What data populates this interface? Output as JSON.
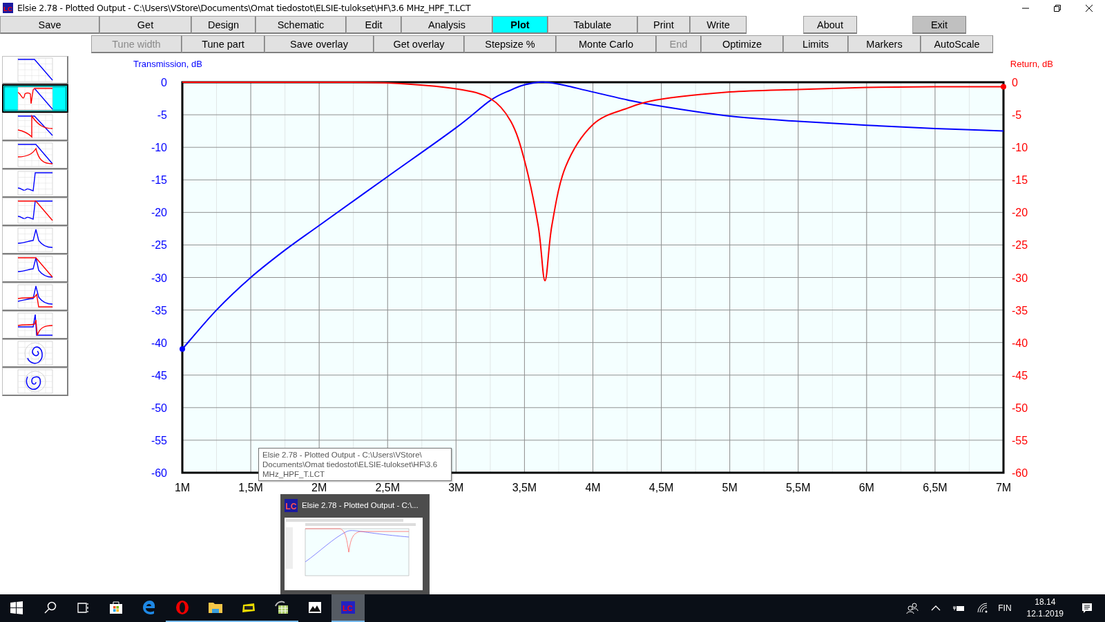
{
  "window": {
    "icon_text": "LC",
    "title": "Elsie 2.78 - Plotted Output - C:\\Users\\VStore\\Documents\\Omat tiedostot\\ELSIE-tulokset\\HF\\3.6 MHz_HPF_T.LCT"
  },
  "menu_row_1": [
    {
      "label": "Save",
      "selected": false,
      "pressed": false
    },
    {
      "label": "Get",
      "selected": false,
      "pressed": false
    },
    {
      "label": "Design",
      "selected": false,
      "pressed": false
    },
    {
      "label": "Schematic",
      "selected": false,
      "pressed": false
    },
    {
      "label": "Edit",
      "selected": false,
      "pressed": false
    },
    {
      "label": "Analysis",
      "selected": false,
      "pressed": false
    },
    {
      "label": "Plot",
      "selected": true,
      "pressed": false
    },
    {
      "label": "Tabulate",
      "selected": false,
      "pressed": false
    },
    {
      "label": "Print",
      "selected": false,
      "pressed": false
    },
    {
      "label": "Write",
      "selected": false,
      "pressed": false
    },
    {
      "label": "About",
      "selected": false,
      "pressed": false
    },
    {
      "label": "Exit",
      "selected": false,
      "pressed": true
    }
  ],
  "menu_row_2": [
    {
      "label": "Tune width",
      "disabled": true
    },
    {
      "label": "Tune part",
      "disabled": false
    },
    {
      "label": "Save overlay",
      "disabled": false
    },
    {
      "label": "Get overlay",
      "disabled": false
    },
    {
      "label": "Stepsize %",
      "disabled": false
    },
    {
      "label": "Monte Carlo",
      "disabled": false
    },
    {
      "label": "End",
      "disabled": true
    },
    {
      "label": "Optimize",
      "disabled": false
    },
    {
      "label": "Limits",
      "disabled": false
    },
    {
      "label": "Markers",
      "disabled": false
    },
    {
      "label": "AutoScale",
      "disabled": false
    }
  ],
  "plot_types": [
    {
      "kind": "transmission",
      "selected": false
    },
    {
      "kind": "trans-return",
      "selected": true
    },
    {
      "kind": "trans-return-cross",
      "selected": false
    },
    {
      "kind": "trans-peak",
      "selected": false
    },
    {
      "kind": "step",
      "selected": false
    },
    {
      "kind": "step-return",
      "selected": false
    },
    {
      "kind": "peak",
      "selected": false
    },
    {
      "kind": "peak-return",
      "selected": false
    },
    {
      "kind": "peak-return-2",
      "selected": false
    },
    {
      "kind": "peak-return-3",
      "selected": false
    },
    {
      "kind": "smith",
      "selected": false
    },
    {
      "kind": "polar",
      "selected": false
    }
  ],
  "chart_data": {
    "type": "line",
    "grid": true,
    "xlim": [
      1,
      7
    ],
    "ylim": [
      -60,
      0
    ],
    "x": [
      1,
      1.25,
      1.5,
      1.75,
      2,
      2.5,
      3,
      3.25,
      3.4,
      3.5,
      3.6,
      3.65,
      3.7,
      3.8,
      4,
      4.25,
      4.5,
      5,
      5.5,
      6,
      6.5,
      7
    ],
    "series": [
      {
        "name": "Transmission, dB",
        "color": "#0000ff",
        "values": [
          -41,
          -35,
          -30,
          -25.8,
          -22,
          -14.5,
          -7,
          -2.8,
          -1.2,
          -0.4,
          0,
          0,
          -0.1,
          -0.5,
          -1.5,
          -2.7,
          -3.7,
          -5.2,
          -6,
          -6.6,
          -7.1,
          -7.5
        ]
      },
      {
        "name": "Return, dB",
        "color": "#ff0000",
        "values": [
          0,
          0,
          0,
          0,
          0,
          -0.1,
          -1,
          -2.5,
          -6,
          -12,
          -22,
          -30.5,
          -22,
          -13,
          -6.5,
          -4,
          -2.6,
          -1.5,
          -1.1,
          -0.8,
          -0.7,
          -0.7
        ]
      }
    ],
    "xticks": [
      {
        "value": 1,
        "label": "1M"
      },
      {
        "value": 1.5,
        "label": "1,5M"
      },
      {
        "value": 2,
        "label": "2M"
      },
      {
        "value": 2.5,
        "label": "2,5M"
      },
      {
        "value": 3,
        "label": "3M"
      },
      {
        "value": 3.5,
        "label": "3,5M"
      },
      {
        "value": 4,
        "label": "4M"
      },
      {
        "value": 4.5,
        "label": "4,5M"
      },
      {
        "value": 5,
        "label": "5M"
      },
      {
        "value": 5.5,
        "label": "5,5M"
      },
      {
        "value": 6,
        "label": "6M"
      },
      {
        "value": 6.5,
        "label": "6,5M"
      },
      {
        "value": 7,
        "label": "7M"
      }
    ],
    "yticks": [
      {
        "value": 0,
        "label": "0"
      },
      {
        "value": -5,
        "label": "-5"
      },
      {
        "value": -10,
        "label": "-10"
      },
      {
        "value": -15,
        "label": "-15"
      },
      {
        "value": -20,
        "label": "-20"
      },
      {
        "value": -25,
        "label": "-25"
      },
      {
        "value": -30,
        "label": "-30"
      },
      {
        "value": -35,
        "label": "-35"
      },
      {
        "value": -40,
        "label": "-40"
      },
      {
        "value": -45,
        "label": "-45"
      },
      {
        "value": -50,
        "label": "-50"
      },
      {
        "value": -55,
        "label": "-55"
      },
      {
        "value": -60,
        "label": "-60"
      }
    ]
  },
  "right_axis": {
    "ticks": [
      "0",
      "-5",
      "-10",
      "-15",
      "-20",
      "-25",
      "-30",
      "-35",
      "-40",
      "-45",
      "-50",
      "-55",
      "-60"
    ]
  },
  "tooltip": {
    "text": "Elsie 2.78 - Plotted Output - C:\\Users\\VStore\\ Documents\\Omat tiedostot\\ELSIE-tulokset\\HF\\3.6 MHz_HPF_T.LCT"
  },
  "preview": {
    "icon_text": "LC",
    "title": "Elsie 2.78 - Plotted Output - C:\\..."
  },
  "taskbar": {
    "apps": [
      {
        "kind": "store",
        "running": false,
        "active": false
      },
      {
        "kind": "edge",
        "running": false,
        "active": false
      },
      {
        "kind": "opera",
        "running": true,
        "active": false
      },
      {
        "kind": "folder",
        "running": true,
        "active": false
      },
      {
        "kind": "pdf",
        "running": true,
        "active": false
      },
      {
        "kind": "sheet",
        "running": true,
        "active": false
      },
      {
        "kind": "photos",
        "running": false,
        "active": false
      },
      {
        "kind": "elsie",
        "running": true,
        "active": true,
        "icon_text": "LC"
      }
    ],
    "language": "FIN",
    "time": "18.14",
    "date": "12.1.2019"
  }
}
